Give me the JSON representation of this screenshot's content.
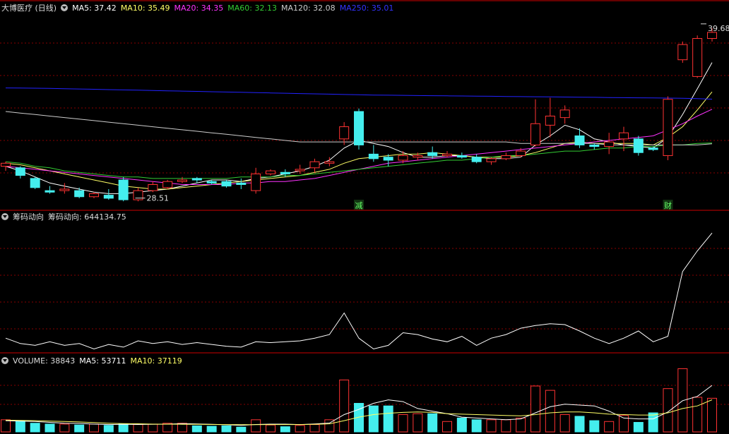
{
  "title": "大博医疗 (日线)",
  "indicators": {
    "ma5": "MA5: 37.42",
    "ma10": "MA10: 35.49",
    "ma20": "MA20: 34.35",
    "ma60": "MA60: 32.13",
    "ma120": "MA120: 32.08",
    "ma250": "MA250: 35.01"
  },
  "chip_panel": {
    "label": "筹码动向",
    "value": "筹码动向: 644134.75"
  },
  "volume_panel": {
    "volume": "VOLUME: 38843",
    "ma5": "MA5: 53711",
    "ma10": "MA10: 37119"
  },
  "colors": {
    "ma5": "#ffffff",
    "ma10": "#ffff66",
    "ma20": "#ff33ff",
    "ma60": "#33cc33",
    "ma120": "#cccccc",
    "ma250": "#2222ff",
    "up": "#ff3333",
    "down": "#44eeee",
    "grid": "#880000"
  },
  "chart_data": {
    "type": "candlestick",
    "price_range": [
      27.8,
      40.6
    ],
    "annotations": {
      "high": "39.68",
      "low": "28.51",
      "event1": "减",
      "event2": "财"
    },
    "candles": [
      [
        30.6,
        30.8,
        30.3,
        30.9
      ],
      [
        30.5,
        30.0,
        29.8,
        30.6
      ],
      [
        29.8,
        29.2,
        29.1,
        29.9
      ],
      [
        29.0,
        28.9,
        28.8,
        29.3
      ],
      [
        29.0,
        29.1,
        28.8,
        29.5
      ],
      [
        29.0,
        28.6,
        28.5,
        29.2
      ],
      [
        28.6,
        28.8,
        28.5,
        28.9
      ],
      [
        28.7,
        28.5,
        28.4,
        29.1
      ],
      [
        29.7,
        28.4,
        28.3,
        29.9
      ],
      [
        28.4,
        29.0,
        28.3,
        29.2
      ],
      [
        29.0,
        29.4,
        28.9,
        29.6
      ],
      [
        29.2,
        29.6,
        29.1,
        29.7
      ],
      [
        29.6,
        29.7,
        29.5,
        29.9
      ],
      [
        29.8,
        29.7,
        29.5,
        29.9
      ],
      [
        29.6,
        29.5,
        29.4,
        29.7
      ],
      [
        29.6,
        29.3,
        29.2,
        29.7
      ],
      [
        29.5,
        29.4,
        29.1,
        29.8
      ],
      [
        29.0,
        30.1,
        28.8,
        30.5
      ],
      [
        30.1,
        30.3,
        30.0,
        30.4
      ],
      [
        30.2,
        30.1,
        29.9,
        30.4
      ],
      [
        30.3,
        30.4,
        30.1,
        30.7
      ],
      [
        30.5,
        30.9,
        30.2,
        31.1
      ],
      [
        30.8,
        30.9,
        30.6,
        31.2
      ],
      [
        32.4,
        33.2,
        32.0,
        33.5
      ],
      [
        34.2,
        32.0,
        31.7,
        34.4
      ],
      [
        31.4,
        31.1,
        30.9,
        32.0
      ],
      [
        31.2,
        31.0,
        30.6,
        31.4
      ],
      [
        31.0,
        31.3,
        30.8,
        31.6
      ],
      [
        31.2,
        31.3,
        31.0,
        31.5
      ],
      [
        31.5,
        31.3,
        31.1,
        31.9
      ],
      [
        31.3,
        31.4,
        31.2,
        31.6
      ],
      [
        31.3,
        31.2,
        31.1,
        31.5
      ],
      [
        31.2,
        30.9,
        30.8,
        31.4
      ],
      [
        30.9,
        31.1,
        30.7,
        31.2
      ],
      [
        31.1,
        31.3,
        31.0,
        31.5
      ],
      [
        31.3,
        31.6,
        31.2,
        31.8
      ],
      [
        32.0,
        33.4,
        31.9,
        35.0
      ],
      [
        33.3,
        33.9,
        32.5,
        35.1
      ],
      [
        33.8,
        34.3,
        33.4,
        34.6
      ],
      [
        32.6,
        32.0,
        31.8,
        33.1
      ],
      [
        32.0,
        31.9,
        31.7,
        32.1
      ],
      [
        31.9,
        32.2,
        31.4,
        32.8
      ],
      [
        32.4,
        32.8,
        31.6,
        33.2
      ],
      [
        32.4,
        31.5,
        31.3,
        32.6
      ],
      [
        31.8,
        31.7,
        31.6,
        31.9
      ],
      [
        31.3,
        35.0,
        31.0,
        35.2
      ],
      [
        37.6,
        38.6,
        37.4,
        38.8
      ],
      [
        36.5,
        39.0,
        36.4,
        39.2
      ],
      [
        39.0,
        39.4,
        38.8,
        39.68
      ]
    ],
    "ma_series": {
      "MA5": [
        30.6,
        30.3,
        29.9,
        29.5,
        29.3,
        29.1,
        28.9,
        28.8,
        28.8,
        28.9,
        29.0,
        29.1,
        29.3,
        29.5,
        29.7,
        29.7,
        29.6,
        29.8,
        29.9,
        30.1,
        30.3,
        30.6,
        31.0,
        31.8,
        32.3,
        32.1,
        31.9,
        31.5,
        31.2,
        31.2,
        31.3,
        31.3,
        31.2,
        31.1,
        31.1,
        31.2,
        32.0,
        32.6,
        33.3,
        33.0,
        32.4,
        32.2,
        32.0,
        31.9,
        31.8,
        32.5,
        34.0,
        35.7,
        37.42
      ],
      "MA10": [
        30.8,
        30.7,
        30.5,
        30.3,
        30.1,
        29.9,
        29.7,
        29.5,
        29.3,
        29.2,
        29.1,
        29.1,
        29.2,
        29.3,
        29.4,
        29.5,
        29.6,
        29.7,
        29.8,
        29.9,
        30.0,
        30.2,
        30.4,
        30.8,
        31.1,
        31.2,
        31.3,
        31.4,
        31.4,
        31.5,
        31.4,
        31.3,
        31.2,
        31.2,
        31.2,
        31.3,
        31.5,
        31.8,
        32.1,
        32.2,
        32.1,
        32.1,
        32.1,
        32.1,
        32.0,
        32.5,
        33.2,
        34.3,
        35.49
      ],
      "MA20": [
        30.6,
        30.5,
        30.4,
        30.3,
        30.2,
        30.1,
        30.0,
        29.9,
        29.8,
        29.7,
        29.6,
        29.5,
        29.4,
        29.4,
        29.4,
        29.4,
        29.5,
        29.5,
        29.6,
        29.6,
        29.7,
        29.8,
        30.0,
        30.2,
        30.4,
        30.6,
        30.8,
        30.9,
        31.0,
        31.1,
        31.2,
        31.3,
        31.4,
        31.5,
        31.6,
        31.7,
        31.8,
        31.9,
        32.0,
        32.1,
        32.2,
        32.3,
        32.4,
        32.5,
        32.6,
        33.0,
        33.4,
        33.9,
        34.35
      ],
      "MA60": [
        30.9,
        30.8,
        30.6,
        30.5,
        30.3,
        30.2,
        30.1,
        30.0,
        29.9,
        29.9,
        29.8,
        29.8,
        29.8,
        29.8,
        29.8,
        29.8,
        29.9,
        29.9,
        29.9,
        30.0,
        30.0,
        30.1,
        30.2,
        30.3,
        30.4,
        30.5,
        30.6,
        30.7,
        30.8,
        30.9,
        31.0,
        31.0,
        31.1,
        31.2,
        31.3,
        31.3,
        31.4,
        31.5,
        31.6,
        31.6,
        31.7,
        31.8,
        31.8,
        31.9,
        31.9,
        32.0,
        32.0,
        32.1,
        32.13
      ],
      "MA120": [
        34.2,
        34.1,
        34.0,
        33.9,
        33.8,
        33.7,
        33.6,
        33.5,
        33.4,
        33.3,
        33.2,
        33.1,
        33.0,
        32.9,
        32.8,
        32.7,
        32.6,
        32.5,
        32.4,
        32.3,
        32.2,
        32.2,
        32.2,
        32.2,
        32.2,
        32.2,
        32.2,
        32.2,
        32.2,
        32.2,
        32.2,
        32.2,
        32.2,
        32.2,
        32.2,
        32.1,
        32.1,
        32.1,
        32.1,
        32.1,
        32.1,
        32.0,
        32.0,
        32.0,
        32.0,
        32.0,
        32.0,
        32.0,
        32.08
      ],
      "MA250": [
        35.75,
        35.74,
        35.73,
        35.72,
        35.7,
        35.68,
        35.66,
        35.64,
        35.62,
        35.6,
        35.58,
        35.56,
        35.54,
        35.52,
        35.5,
        35.48,
        35.46,
        35.44,
        35.42,
        35.4,
        35.38,
        35.36,
        35.34,
        35.32,
        35.3,
        35.28,
        35.27,
        35.26,
        35.25,
        35.24,
        35.23,
        35.22,
        35.21,
        35.2,
        35.19,
        35.18,
        35.17,
        35.16,
        35.15,
        35.14,
        35.13,
        35.12,
        35.11,
        35.1,
        35.09,
        35.08,
        35.07,
        35.05,
        35.01
      ]
    },
    "chip_values": [
      60000,
      30000,
      20000,
      40000,
      20000,
      30000,
      0,
      25000,
      10000,
      45000,
      30000,
      40000,
      25000,
      35000,
      25000,
      15000,
      10000,
      40000,
      35000,
      40000,
      45000,
      60000,
      80000,
      200000,
      60000,
      0,
      20000,
      90000,
      80000,
      55000,
      40000,
      70000,
      20000,
      60000,
      80000,
      115000,
      130000,
      140000,
      135000,
      100000,
      60000,
      30000,
      60000,
      100000,
      40000,
      70000,
      430000,
      545000,
      644134.75
    ],
    "volumes": [
      14000,
      13000,
      10000,
      9000,
      9000,
      8000,
      9000,
      7500,
      9000,
      8500,
      9000,
      10000,
      10000,
      7000,
      6500,
      7000,
      5500,
      14000,
      8000,
      6000,
      7500,
      8500,
      14000,
      60000,
      33000,
      30000,
      30000,
      20000,
      21000,
      21000,
      12000,
      16000,
      14000,
      14000,
      14000,
      16000,
      53000,
      48000,
      20000,
      18000,
      13000,
      12000,
      19000,
      11000,
      22000,
      50000,
      73000,
      40000,
      38843
    ],
    "volume_ma5": [
      13000,
      12500,
      12000,
      11000,
      10000,
      9800,
      9000,
      8500,
      8700,
      8600,
      8700,
      9000,
      9500,
      9200,
      8800,
      8200,
      7500,
      8600,
      9000,
      9000,
      8500,
      9200,
      10200,
      20000,
      26000,
      33000,
      37000,
      35000,
      27000,
      24000,
      21000,
      17000,
      16000,
      15000,
      14000,
      15000,
      22000,
      29000,
      32000,
      31000,
      30000,
      24000,
      16000,
      15000,
      15000,
      23000,
      36000,
      41000,
      53711
    ],
    "volume_ma10": [
      13500,
      13300,
      13000,
      12500,
      12000,
      11500,
      10800,
      10000,
      9600,
      9400,
      9000,
      8900,
      8800,
      8700,
      8600,
      8500,
      8300,
      8400,
      8500,
      8500,
      8500,
      8700,
      9300,
      13000,
      17000,
      20000,
      21500,
      22500,
      23000,
      22500,
      21000,
      20500,
      20000,
      19500,
      19000,
      18500,
      20000,
      22000,
      23000,
      23000,
      22000,
      20500,
      20000,
      19500,
      19500,
      22000,
      27000,
      30000,
      37119
    ],
    "volume_max": 75000,
    "chip_range": [
      -10000,
      700000
    ]
  }
}
